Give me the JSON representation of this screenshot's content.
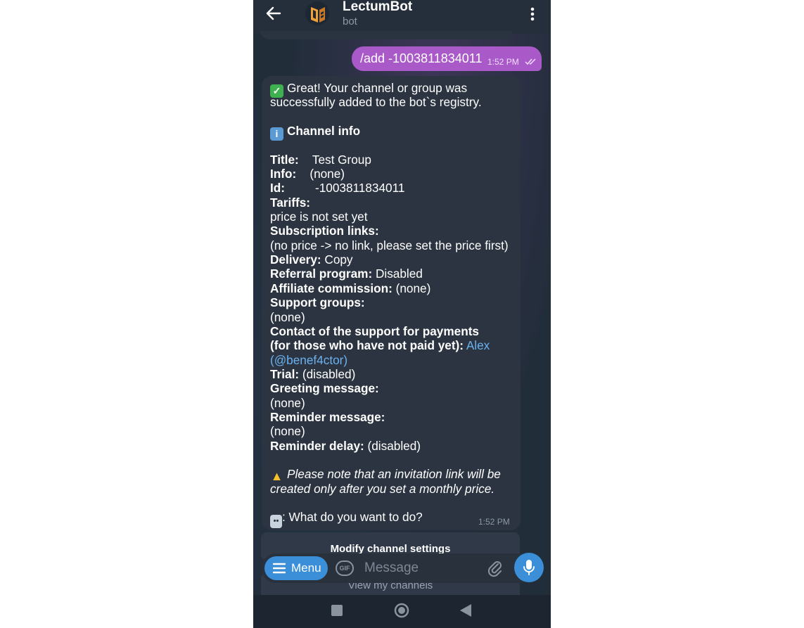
{
  "header": {
    "title": "LectumBot",
    "subtitle": "bot"
  },
  "outgoing": {
    "text": "/add -1003811834011",
    "time": "1:52 PM"
  },
  "incoming": {
    "time": "1:52 PM",
    "line1": "Great! Your channel or group was",
    "line2": "successfully added to the bot`s registry.",
    "channel_info": "Channel info",
    "title_label": "Title:",
    "title_value": "Test Group",
    "info_label": "Info:",
    "info_value": "(none)",
    "id_label": "Id:",
    "id_value": "-1003811834011",
    "tariffs_label": "Tariffs:",
    "tariffs_value": "price is not set yet",
    "sublinks_label": "Subscription links:",
    "sublinks_value": "(no price -> no link, please set the price first)",
    "delivery_label": "Delivery:",
    "delivery_value": "Copy",
    "referral_label": "Referral program:",
    "referral_value": "Disabled",
    "affiliate_label": "Affiliate commission:",
    "affiliate_value": "(none)",
    "support_groups_label": "Support groups:",
    "support_groups_value": "(none)",
    "contact_label1": "Contact of the support for payments",
    "contact_label2": "(for those who have not paid yet):",
    "contact_link1": "Alex",
    "contact_link2": "(@benef4ctor)",
    "trial_label": "Trial:",
    "trial_value": "(disabled)",
    "greeting_label": "Greeting message:",
    "greeting_value": "(none)",
    "reminder_label": "Reminder message:",
    "reminder_value": "(none)",
    "delay_label": "Reminder delay:",
    "delay_value": "(disabled)",
    "note1": "Please note that an invitation link will be",
    "note2": "created only after you set a monthly price.",
    "question": ": What do you want to do?"
  },
  "keyboard": {
    "button1": "Modify channel settings",
    "button2": "View my channels"
  },
  "input": {
    "menu_label": "Menu",
    "gif_label": "GIF",
    "placeholder": "Message"
  },
  "icons": {
    "back": "arrow-left-icon",
    "more": "kebab-icon",
    "check": "check-mark-emoji",
    "info": "info-emoji",
    "warning": "warning-emoji",
    "robot": "robot-emoji",
    "attach": "paperclip-icon",
    "mic": "microphone-icon",
    "menu": "hamburger-icon"
  },
  "colors": {
    "outgoing_bubble": "#a95ac8",
    "incoming_bubble": "#2b3440",
    "accent": "#3a8fd8",
    "link": "#6ab2f2"
  }
}
